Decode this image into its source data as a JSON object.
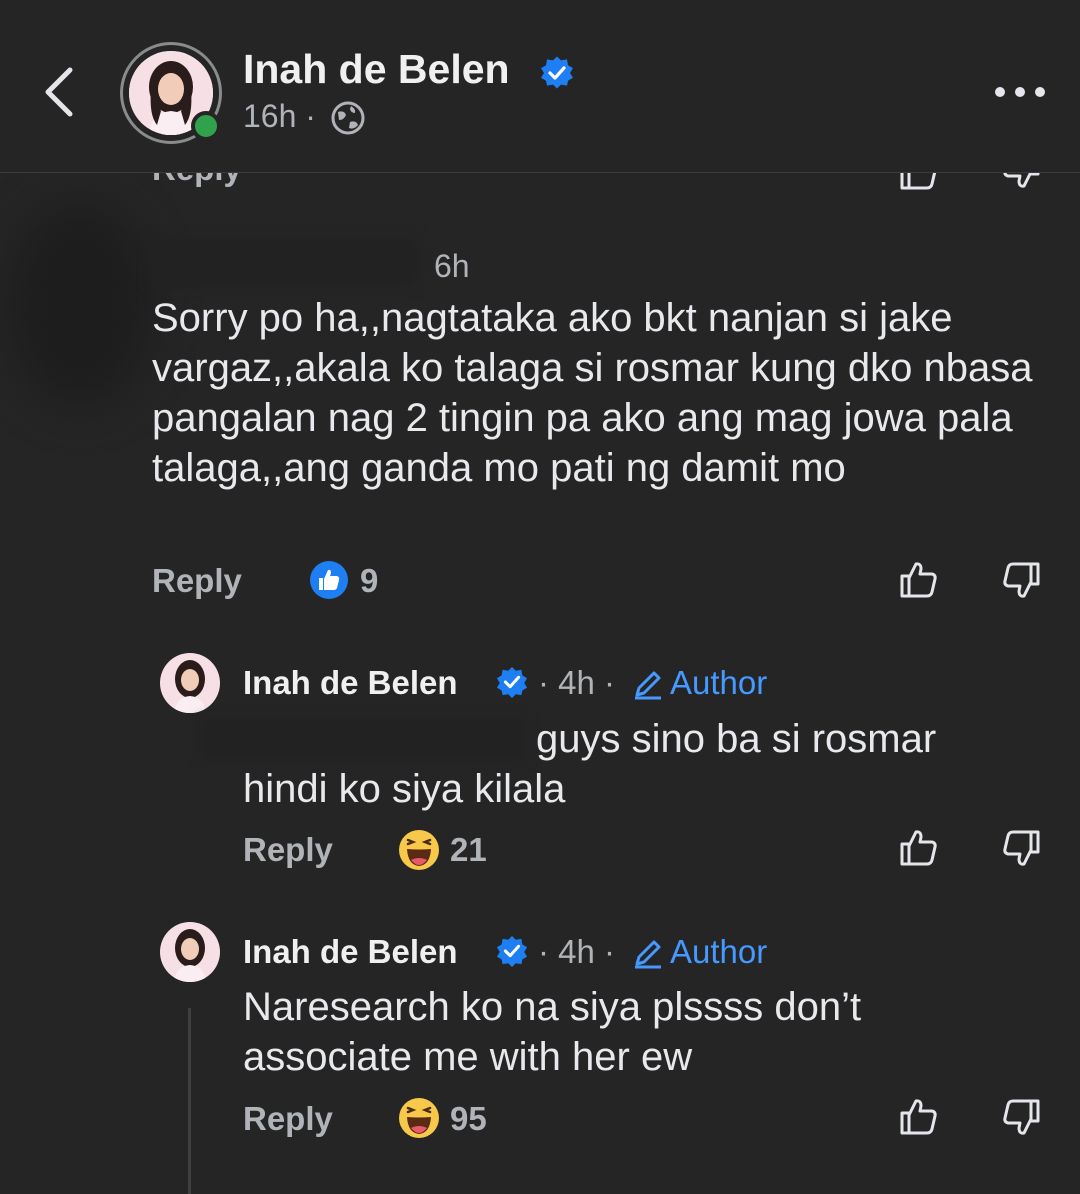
{
  "header": {
    "name": "Inah de Belen",
    "time": "16h",
    "separator": "·"
  },
  "cutoff_row": {
    "reply_label": "Reply"
  },
  "comment": {
    "time": "6h",
    "text": "Sorry po ha,,nagtataka ako bkt nanjan si jake vargaz,,akala ko talaga si rosmar kung dko nbasa pangalan nag 2 tingin pa ako ang mag jowa pala talaga,,ang ganda mo pati ng damit mo",
    "reply_label": "Reply",
    "reaction": "like",
    "reaction_count": "9"
  },
  "replies": [
    {
      "name": "Inah de Belen",
      "meta": "· 4h ·",
      "author_label": "Author",
      "text_line1": "guys sino ba si rosmar",
      "text_line2": "hindi ko siya kilala",
      "reply_label": "Reply",
      "reaction": "haha",
      "reaction_count": "21"
    },
    {
      "name": "Inah de Belen",
      "meta": "· 4h ·",
      "author_label": "Author",
      "text_line1": "Naresearch ko na siya plssss don’t",
      "text_line2": "associate me with her ew",
      "reply_label": "Reply",
      "reaction": "haha",
      "reaction_count": "95"
    }
  ],
  "colors": {
    "background": "#252526",
    "verified": "#1d7ff2",
    "author": "#4599ff",
    "online": "#31a24c",
    "muted": "#b0b3b8"
  }
}
